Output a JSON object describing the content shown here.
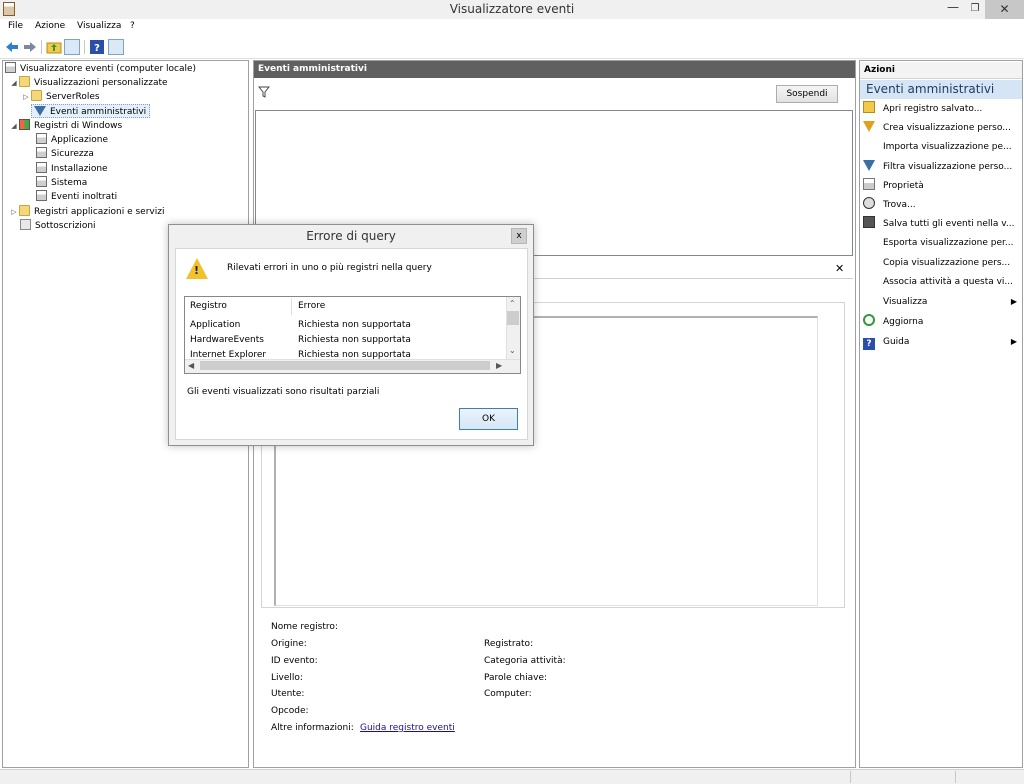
{
  "window": {
    "title": "Visualizzatore eventi",
    "minimize_glyph": "—",
    "maximize_glyph": "❐",
    "close_glyph": "✕"
  },
  "menu": [
    "File",
    "Azione",
    "Visualizza",
    "?"
  ],
  "tree": {
    "root": "Visualizzatore eventi (computer locale)",
    "custom_views": "Visualizzazioni personalizzate",
    "server_roles": "ServerRoles",
    "admin_events": "Eventi amministrativi",
    "windows_logs": "Registri di Windows",
    "application": "Applicazione",
    "security": "Sicurezza",
    "setup": "Installazione",
    "system": "Sistema",
    "forwarded": "Eventi inoltrati",
    "apps_services": "Registri applicazioni e servizi",
    "subscriptions": "Sottoscrizioni"
  },
  "center": {
    "header": "Eventi amministrativi",
    "stop_button": "Sospendi",
    "close_glyph": "✕",
    "fields": {
      "log_name": "Nome registro:",
      "source": "Origine:",
      "logged": "Registrato:",
      "event_id": "ID evento:",
      "task_category": "Categoria attività:",
      "level": "Livello:",
      "keywords": "Parole chiave:",
      "user": "Utente:",
      "computer": "Computer:",
      "opcode": "Opcode:",
      "more_info": "Altre informazioni:",
      "more_info_link": "Guida registro eventi"
    }
  },
  "actions": {
    "title": "Azioni",
    "section": "Eventi amministrativi",
    "items": [
      "Apri registro salvato...",
      "Crea visualizzazione perso...",
      "Importa visualizzazione pe...",
      "Filtra visualizzazione perso...",
      "Proprietà",
      "Trova...",
      "Salva tutti gli eventi nella v...",
      "Esporta visualizzazione per...",
      "Copia visualizzazione pers...",
      "Associa attività a questa vi...",
      "Visualizza",
      "Aggiorna",
      "Guida"
    ]
  },
  "dialog": {
    "title": "Errore di query",
    "close_glyph": "x",
    "message": "Rilevati errori in uno o più registri nella query",
    "columns": [
      "Registro",
      "Errore"
    ],
    "rows": [
      {
        "log": "Application",
        "error": "Richiesta non supportata"
      },
      {
        "log": "HardwareEvents",
        "error": "Richiesta non supportata"
      },
      {
        "log": "Internet Explorer",
        "error": "Richiesta non supportata"
      }
    ],
    "note": "Gli eventi visualizzati sono risultati parziali",
    "ok": "OK"
  }
}
